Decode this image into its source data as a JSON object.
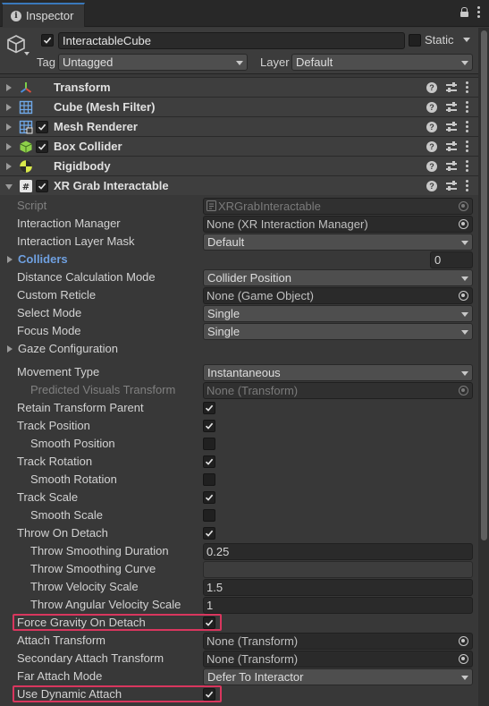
{
  "tab": {
    "title": "Inspector",
    "icon": "info-icon"
  },
  "header": {
    "object_name": "InteractableCube",
    "active": true,
    "static_label": "Static",
    "static_checked": false,
    "tag_label": "Tag",
    "tag_value": "Untagged",
    "layer_label": "Layer",
    "layer_value": "Default"
  },
  "components": [
    {
      "name": "Transform",
      "icon": "transform-icon",
      "has_checkbox": false
    },
    {
      "name": "Cube (Mesh Filter)",
      "icon": "mesh-filter-icon",
      "has_checkbox": false
    },
    {
      "name": "Mesh Renderer",
      "icon": "mesh-renderer-icon",
      "has_checkbox": true,
      "enabled": true
    },
    {
      "name": "Box Collider",
      "icon": "box-collider-icon",
      "has_checkbox": true,
      "enabled": true
    },
    {
      "name": "Rigidbody",
      "icon": "rigidbody-icon",
      "has_checkbox": false
    },
    {
      "name": "XR Grab Interactable",
      "icon": "script-icon",
      "has_checkbox": true,
      "enabled": true,
      "expanded": true
    }
  ],
  "xr_grab": {
    "script_label": "Script",
    "script_value": "XRGrabInteractable",
    "interaction_manager_label": "Interaction Manager",
    "interaction_manager_value": "None (XR Interaction Manager)",
    "interaction_layer_mask_label": "Interaction Layer Mask",
    "interaction_layer_mask_value": "Default",
    "colliders_label": "Colliders",
    "colliders_count": "0",
    "distance_calc_label": "Distance Calculation Mode",
    "distance_calc_value": "Collider Position",
    "custom_reticle_label": "Custom Reticle",
    "custom_reticle_value": "None (Game Object)",
    "select_mode_label": "Select Mode",
    "select_mode_value": "Single",
    "focus_mode_label": "Focus Mode",
    "focus_mode_value": "Single",
    "gaze_config_label": "Gaze Configuration",
    "movement_type_label": "Movement Type",
    "movement_type_value": "Instantaneous",
    "predicted_visuals_label": "Predicted Visuals Transform",
    "predicted_visuals_value": "None (Transform)",
    "retain_parent_label": "Retain Transform Parent",
    "retain_parent": true,
    "track_position_label": "Track Position",
    "track_position": true,
    "smooth_position_label": "Smooth Position",
    "smooth_position": false,
    "track_rotation_label": "Track Rotation",
    "track_rotation": true,
    "smooth_rotation_label": "Smooth Rotation",
    "smooth_rotation": false,
    "track_scale_label": "Track Scale",
    "track_scale": true,
    "smooth_scale_label": "Smooth Scale",
    "smooth_scale": false,
    "throw_on_detach_label": "Throw On Detach",
    "throw_on_detach": true,
    "throw_smoothing_duration_label": "Throw Smoothing Duration",
    "throw_smoothing_duration": "0.25",
    "throw_smoothing_curve_label": "Throw Smoothing Curve",
    "throw_velocity_scale_label": "Throw Velocity Scale",
    "throw_velocity_scale": "1.5",
    "throw_angular_velocity_scale_label": "Throw Angular Velocity Scale",
    "throw_angular_velocity_scale": "1",
    "force_gravity_label": "Force Gravity On Detach",
    "force_gravity": true,
    "attach_transform_label": "Attach Transform",
    "attach_transform_value": "None (Transform)",
    "secondary_attach_label": "Secondary Attach Transform",
    "secondary_attach_value": "None (Transform)",
    "far_attach_mode_label": "Far Attach Mode",
    "far_attach_mode_value": "Defer To Interactor",
    "use_dynamic_attach_label": "Use Dynamic Attach",
    "use_dynamic_attach": true
  },
  "colors": {
    "background": "#383838",
    "tab_accent": "#3a79bb",
    "highlight": "#d9365e",
    "link_blue": "#6fa0e0"
  }
}
